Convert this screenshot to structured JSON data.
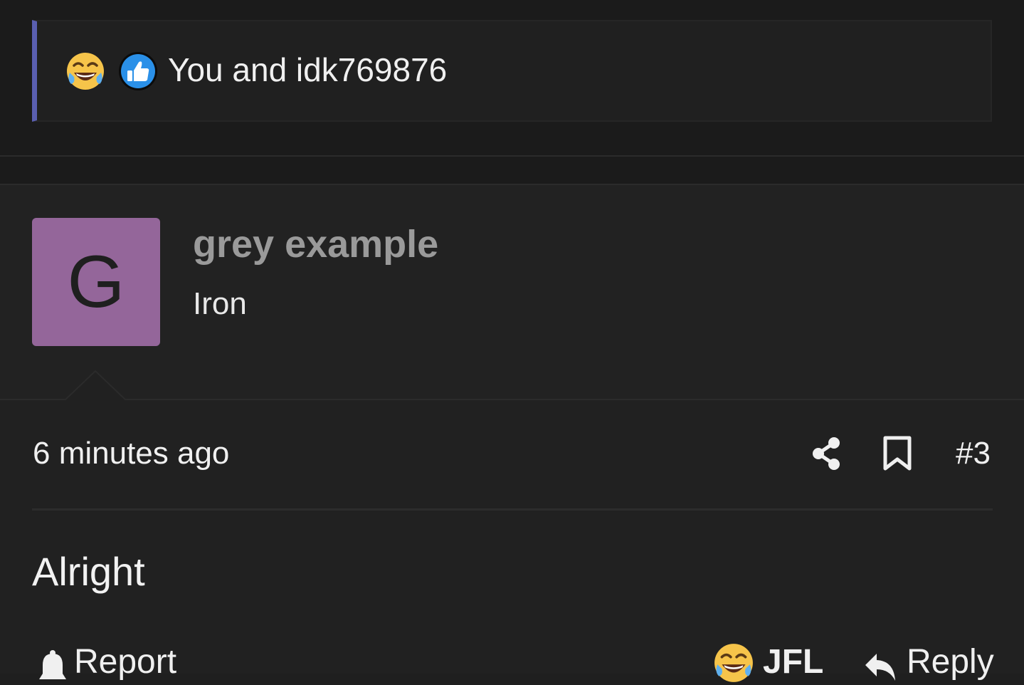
{
  "reactions_summary": {
    "icons": [
      "laughing-tears-icon",
      "thumbs-up-icon"
    ],
    "text": "You and idk769876",
    "accent_color": "#5a5fb0"
  },
  "user": {
    "avatar_letter": "G",
    "avatar_color": "#94669a",
    "name": "grey example",
    "title": "Iron"
  },
  "post": {
    "timestamp": "6 minutes ago",
    "number": "#3",
    "body": "Alright"
  },
  "actions": {
    "report_label": "Report",
    "react_label": "JFL",
    "react_icon": "laughing-tears-icon",
    "reply_label": "Reply"
  }
}
